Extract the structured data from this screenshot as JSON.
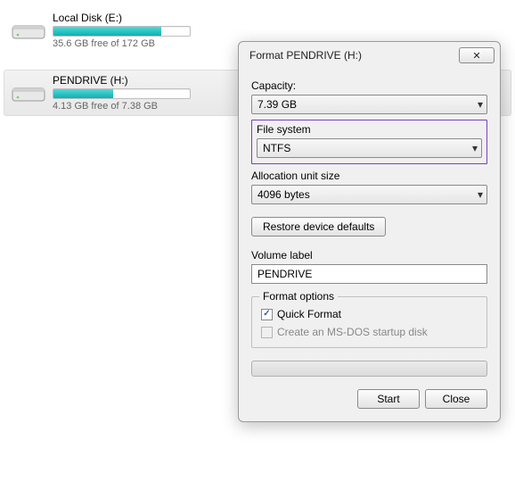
{
  "drives": {
    "item0": {
      "name": "Local Disk (E:)",
      "free_text": "35.6 GB free of 172 GB",
      "percent_used": 0.79
    },
    "item1": {
      "name": "PENDRIVE (H:)",
      "free_text": "4.13 GB free of 7.38 GB",
      "percent_used": 0.44
    }
  },
  "dialog": {
    "title": "Format PENDRIVE (H:)",
    "capacity_label": "Capacity:",
    "capacity_value": "7.39 GB",
    "filesystem_label": "File system",
    "filesystem_value": "NTFS",
    "allocation_label": "Allocation unit size",
    "allocation_value": "4096 bytes",
    "restore_defaults": "Restore device defaults",
    "volume_label_label": "Volume label",
    "volume_label_value": "PENDRIVE",
    "format_options_legend": "Format options",
    "quick_format_label": "Quick Format",
    "quick_format_checked": true,
    "msdos_label": "Create an MS-DOS startup disk",
    "msdos_checked": false,
    "msdos_enabled": false,
    "start_label": "Start",
    "close_label": "Close"
  }
}
